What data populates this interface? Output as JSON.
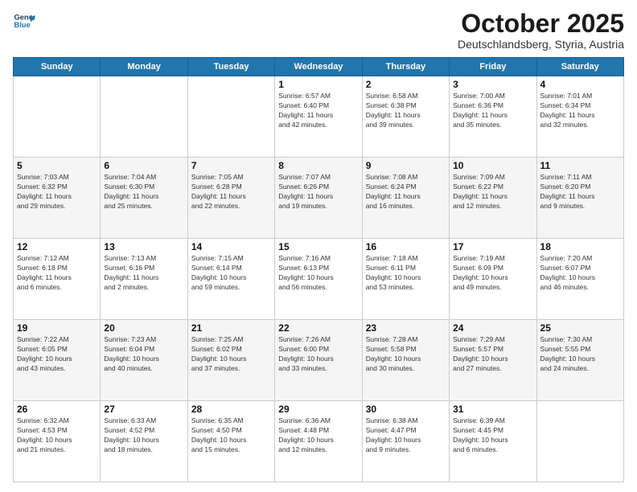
{
  "header": {
    "logo_line1": "General",
    "logo_line2": "Blue",
    "month": "October 2025",
    "location": "Deutschlandsberg, Styria, Austria"
  },
  "weekdays": [
    "Sunday",
    "Monday",
    "Tuesday",
    "Wednesday",
    "Thursday",
    "Friday",
    "Saturday"
  ],
  "weeks": [
    [
      {
        "day": "",
        "text": ""
      },
      {
        "day": "",
        "text": ""
      },
      {
        "day": "",
        "text": ""
      },
      {
        "day": "1",
        "text": "Sunrise: 6:57 AM\nSunset: 6:40 PM\nDaylight: 11 hours\nand 42 minutes."
      },
      {
        "day": "2",
        "text": "Sunrise: 6:58 AM\nSunset: 6:38 PM\nDaylight: 11 hours\nand 39 minutes."
      },
      {
        "day": "3",
        "text": "Sunrise: 7:00 AM\nSunset: 6:36 PM\nDaylight: 11 hours\nand 35 minutes."
      },
      {
        "day": "4",
        "text": "Sunrise: 7:01 AM\nSunset: 6:34 PM\nDaylight: 11 hours\nand 32 minutes."
      }
    ],
    [
      {
        "day": "5",
        "text": "Sunrise: 7:03 AM\nSunset: 6:32 PM\nDaylight: 11 hours\nand 29 minutes."
      },
      {
        "day": "6",
        "text": "Sunrise: 7:04 AM\nSunset: 6:30 PM\nDaylight: 11 hours\nand 25 minutes."
      },
      {
        "day": "7",
        "text": "Sunrise: 7:05 AM\nSunset: 6:28 PM\nDaylight: 11 hours\nand 22 minutes."
      },
      {
        "day": "8",
        "text": "Sunrise: 7:07 AM\nSunset: 6:26 PM\nDaylight: 11 hours\nand 19 minutes."
      },
      {
        "day": "9",
        "text": "Sunrise: 7:08 AM\nSunset: 6:24 PM\nDaylight: 11 hours\nand 16 minutes."
      },
      {
        "day": "10",
        "text": "Sunrise: 7:09 AM\nSunset: 6:22 PM\nDaylight: 11 hours\nand 12 minutes."
      },
      {
        "day": "11",
        "text": "Sunrise: 7:11 AM\nSunset: 6:20 PM\nDaylight: 11 hours\nand 9 minutes."
      }
    ],
    [
      {
        "day": "12",
        "text": "Sunrise: 7:12 AM\nSunset: 6:18 PM\nDaylight: 11 hours\nand 6 minutes."
      },
      {
        "day": "13",
        "text": "Sunrise: 7:13 AM\nSunset: 6:16 PM\nDaylight: 11 hours\nand 2 minutes."
      },
      {
        "day": "14",
        "text": "Sunrise: 7:15 AM\nSunset: 6:14 PM\nDaylight: 10 hours\nand 59 minutes."
      },
      {
        "day": "15",
        "text": "Sunrise: 7:16 AM\nSunset: 6:13 PM\nDaylight: 10 hours\nand 56 minutes."
      },
      {
        "day": "16",
        "text": "Sunrise: 7:18 AM\nSunset: 6:11 PM\nDaylight: 10 hours\nand 53 minutes."
      },
      {
        "day": "17",
        "text": "Sunrise: 7:19 AM\nSunset: 6:09 PM\nDaylight: 10 hours\nand 49 minutes."
      },
      {
        "day": "18",
        "text": "Sunrise: 7:20 AM\nSunset: 6:07 PM\nDaylight: 10 hours\nand 46 minutes."
      }
    ],
    [
      {
        "day": "19",
        "text": "Sunrise: 7:22 AM\nSunset: 6:05 PM\nDaylight: 10 hours\nand 43 minutes."
      },
      {
        "day": "20",
        "text": "Sunrise: 7:23 AM\nSunset: 6:04 PM\nDaylight: 10 hours\nand 40 minutes."
      },
      {
        "day": "21",
        "text": "Sunrise: 7:25 AM\nSunset: 6:02 PM\nDaylight: 10 hours\nand 37 minutes."
      },
      {
        "day": "22",
        "text": "Sunrise: 7:26 AM\nSunset: 6:00 PM\nDaylight: 10 hours\nand 33 minutes."
      },
      {
        "day": "23",
        "text": "Sunrise: 7:28 AM\nSunset: 5:58 PM\nDaylight: 10 hours\nand 30 minutes."
      },
      {
        "day": "24",
        "text": "Sunrise: 7:29 AM\nSunset: 5:57 PM\nDaylight: 10 hours\nand 27 minutes."
      },
      {
        "day": "25",
        "text": "Sunrise: 7:30 AM\nSunset: 5:55 PM\nDaylight: 10 hours\nand 24 minutes."
      }
    ],
    [
      {
        "day": "26",
        "text": "Sunrise: 6:32 AM\nSunset: 4:53 PM\nDaylight: 10 hours\nand 21 minutes."
      },
      {
        "day": "27",
        "text": "Sunrise: 6:33 AM\nSunset: 4:52 PM\nDaylight: 10 hours\nand 18 minutes."
      },
      {
        "day": "28",
        "text": "Sunrise: 6:35 AM\nSunset: 4:50 PM\nDaylight: 10 hours\nand 15 minutes."
      },
      {
        "day": "29",
        "text": "Sunrise: 6:36 AM\nSunset: 4:48 PM\nDaylight: 10 hours\nand 12 minutes."
      },
      {
        "day": "30",
        "text": "Sunrise: 6:38 AM\nSunset: 4:47 PM\nDaylight: 10 hours\nand 9 minutes."
      },
      {
        "day": "31",
        "text": "Sunrise: 6:39 AM\nSunset: 4:45 PM\nDaylight: 10 hours\nand 6 minutes."
      },
      {
        "day": "",
        "text": ""
      }
    ]
  ]
}
